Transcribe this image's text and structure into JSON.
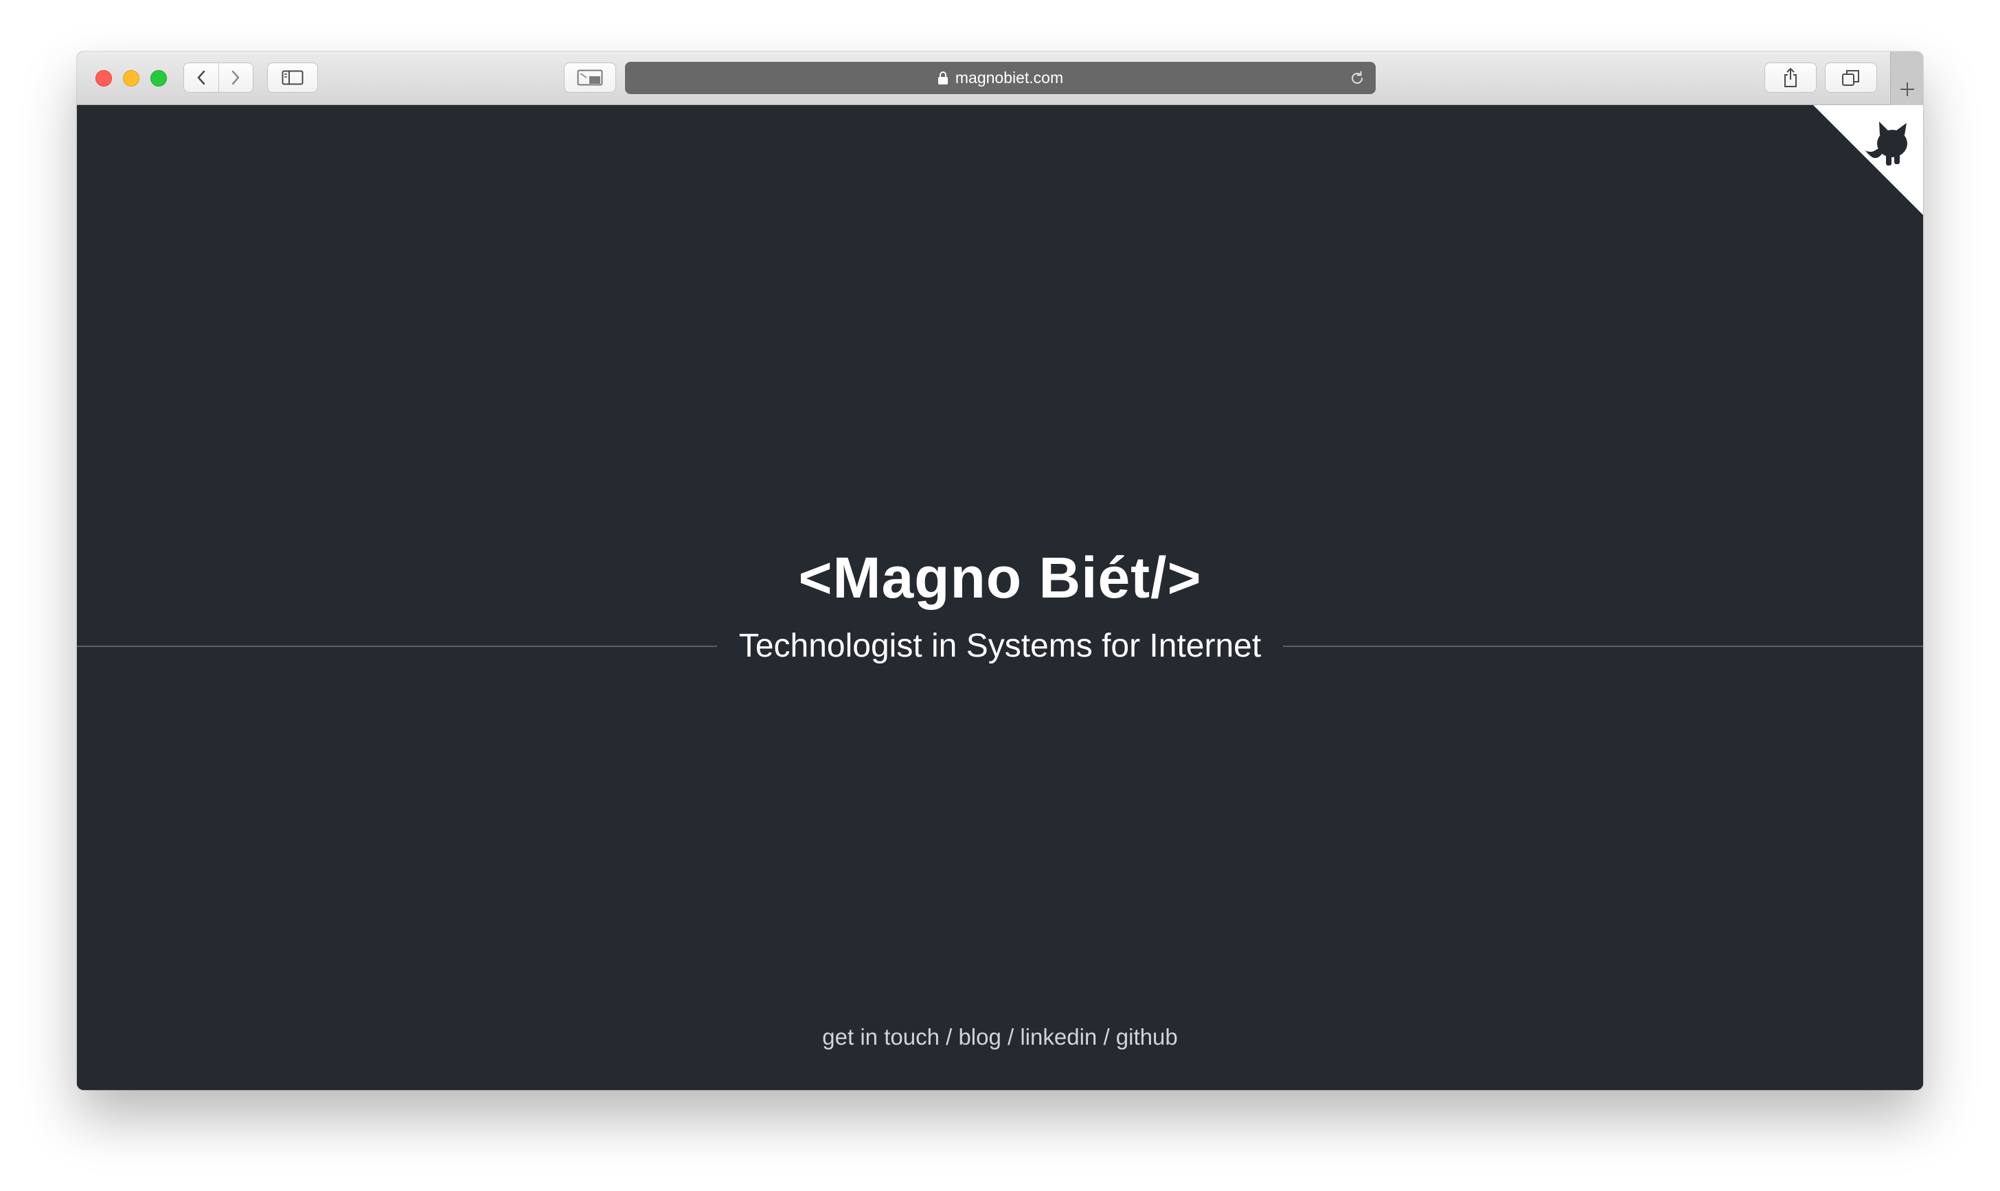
{
  "browser": {
    "url": "magnobiet.com",
    "icons": {
      "back": "chevron-left-icon",
      "forward": "chevron-right-icon",
      "sidebar": "sidebar-icon",
      "reader": "reader-icon",
      "lock": "lock-icon",
      "reload": "reload-icon",
      "share": "share-icon",
      "tabs": "tabs-icon",
      "new_tab": "plus-icon"
    }
  },
  "page": {
    "title": "<Magno Biét/>",
    "tagline": "Technologist in Systems for Internet",
    "links": [
      {
        "label": "get in touch"
      },
      {
        "label": "blog"
      },
      {
        "label": "linkedin"
      },
      {
        "label": "github"
      }
    ],
    "separator": "/",
    "corner_icon": "github-octocat-icon"
  },
  "colors": {
    "background": "#252930",
    "text": "#ffffff",
    "link_text": "#d2d4d8",
    "corner": "#ffffff"
  }
}
